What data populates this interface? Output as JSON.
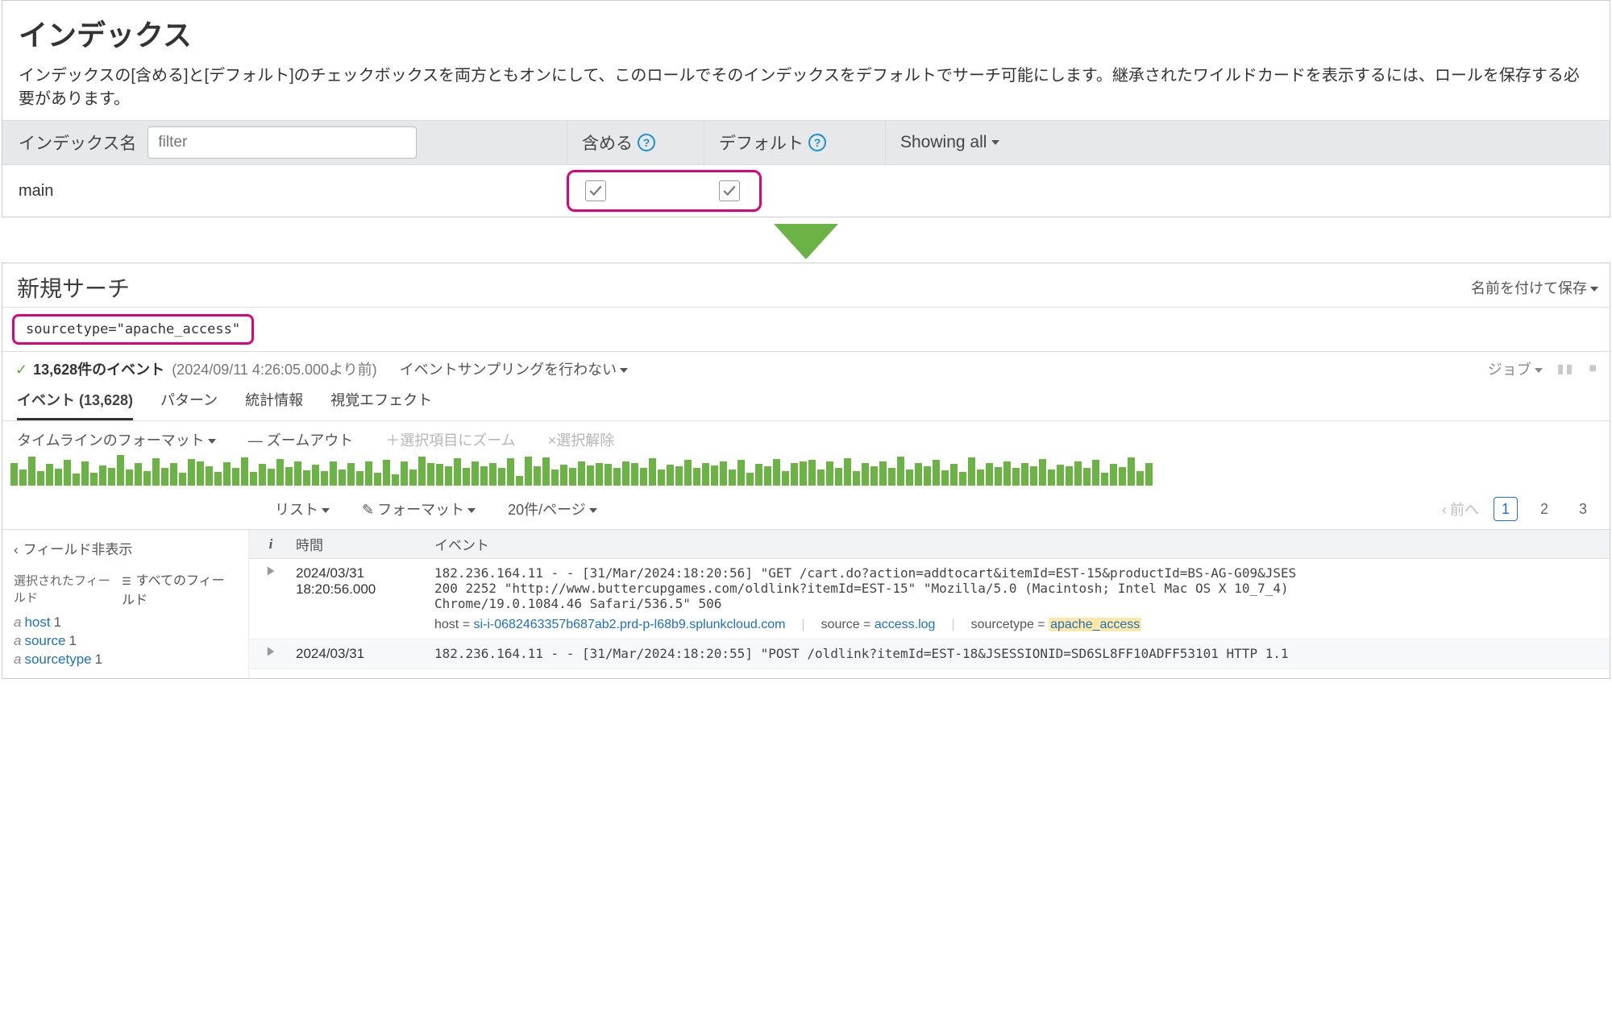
{
  "indexes": {
    "title": "インデックス",
    "description": "インデックスの[含める]と[デフォルト]のチェックボックスを両方ともオンにして、このロールでそのインデックスをデフォルトでサーチ可能にします。継承されたワイルドカードを表示するには、ロールを保存する必要があります。",
    "col_name": "インデックス名",
    "filter_placeholder": "filter",
    "col_include": "含める",
    "col_default": "デフォルト",
    "showing": "Showing all",
    "row0_name": "main"
  },
  "search": {
    "title": "新規サーチ",
    "save_as": "名前を付けて保存",
    "query": "sourcetype=\"apache_access\"",
    "status_count": "13,628件のイベント",
    "status_time": "(2024/09/11 4:26:05.000より前)",
    "sampling": "イベントサンプリングを行わない",
    "job": "ジョブ"
  },
  "tabs": {
    "events": "イベント (13,628)",
    "patterns": "パターン",
    "stats": "統計情報",
    "viz": "視覚エフェクト"
  },
  "timeline": {
    "format": "タイムラインのフォーマット",
    "zoom_out": "— ズームアウト",
    "zoom_sel": "＋選択項目にズーム",
    "deselect": "×選択解除"
  },
  "list": {
    "list": "リスト",
    "format": "フォーマット",
    "per_page": "20件/ページ",
    "prev": "前へ",
    "p1": "1",
    "p2": "2",
    "p3": "3"
  },
  "sidebar": {
    "hide": "フィールド非表示",
    "selected": "選択されたフィールド",
    "all": "すべてのフィールド",
    "f_host": "host",
    "f_host_c": "1",
    "f_source": "source",
    "f_source_c": "1",
    "f_sourcetype": "sourcetype",
    "f_sourcetype_c": "1"
  },
  "evhead": {
    "i": "i",
    "time": "時間",
    "event": "イベント"
  },
  "events": [
    {
      "time_l1": "2024/03/31",
      "time_l2": "18:20:56.000",
      "line1": "182.236.164.11 - - [31/Mar/2024:18:20:56] \"GET /cart.do?action=addtocart&itemId=EST-15&productId=BS-AG-G09&JSES",
      "line2": "200 2252 \"http://www.buttercupgames.com/oldlink?itemId=EST-15\" \"Mozilla/5.0 (Macintosh; Intel Mac OS X 10_7_4)",
      "line3": "Chrome/19.0.1084.46 Safari/536.5\" 506",
      "meta_host_k": "host =",
      "meta_host_v": "si-i-0682463357b687ab2.prd-p-l68b9.splunkcloud.com",
      "meta_src_k": "source =",
      "meta_src_v": "access.log",
      "meta_st_k": "sourcetype =",
      "meta_st_v": "apache_access"
    },
    {
      "time_l1": "2024/03/31",
      "time_l2": "",
      "line1": "182.236.164.11 - - [31/Mar/2024:18:20:55] \"POST /oldlink?itemId=EST-18&JSESSIONID=SD6SL8FF10ADFF53101 HTTP 1.1"
    }
  ],
  "chart_data": {
    "type": "bar",
    "title": "event timeline",
    "ylim": [
      0,
      40
    ],
    "values": [
      28,
      20,
      36,
      18,
      27,
      21,
      32,
      15,
      30,
      16,
      25,
      22,
      38,
      20,
      28,
      18,
      34,
      22,
      28,
      16,
      33,
      30,
      24,
      17,
      29,
      22,
      35,
      17,
      27,
      21,
      33,
      23,
      30,
      19,
      26,
      18,
      30,
      20,
      28,
      18,
      30,
      16,
      32,
      14,
      30,
      20,
      36,
      28,
      27,
      24,
      34,
      22,
      30,
      24,
      28,
      22,
      34,
      12,
      36,
      24,
      35,
      20,
      26,
      22,
      30,
      25,
      28,
      27,
      22,
      30,
      28,
      22,
      34,
      20,
      26,
      24,
      32,
      22,
      28,
      25,
      30,
      20,
      32,
      16,
      27,
      24,
      33,
      18,
      28,
      30,
      32,
      20,
      30,
      22,
      34,
      18,
      28,
      24,
      30,
      22,
      36,
      20,
      28,
      24,
      32,
      19,
      27,
      17,
      35,
      20,
      28,
      23,
      30,
      22,
      28,
      24,
      33,
      20,
      26,
      24,
      30,
      22,
      32,
      16,
      27,
      23,
      35,
      18,
      28
    ]
  }
}
